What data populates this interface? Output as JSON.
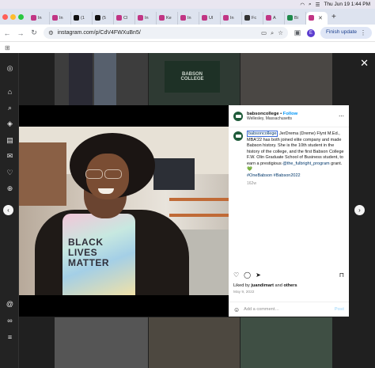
{
  "menubar": {
    "datetime": "Thu Jun 19  1:44 PM"
  },
  "tabs": [
    {
      "label": "In",
      "color": "#c13584"
    },
    {
      "label": "In",
      "color": "#c13584"
    },
    {
      "label": "(1",
      "color": "#111111"
    },
    {
      "label": "(5",
      "color": "#111111"
    },
    {
      "label": "Cl",
      "color": "#c13584"
    },
    {
      "label": "In",
      "color": "#c13584"
    },
    {
      "label": "Ke",
      "color": "#c13584"
    },
    {
      "label": "In",
      "color": "#c13584"
    },
    {
      "label": "Ul",
      "color": "#c13584"
    },
    {
      "label": "In",
      "color": "#c13584"
    },
    {
      "label": "Fc",
      "color": "#333333"
    },
    {
      "label": "A",
      "color": "#c13584"
    },
    {
      "label": "Bi",
      "color": "#1f8a4c"
    },
    {
      "label": "",
      "color": "#c13584"
    }
  ],
  "toolbar": {
    "url": "instagram.com/p/CdV4FWXuBn5/",
    "profile_initial": "E",
    "finish_update": "Finish update"
  },
  "post": {
    "username": "babsoncollege",
    "follow": "Follow",
    "location": "Wellesley, Massachusetts",
    "caption_mention": "babsoncollege",
    "caption_body": " JerDrema (Dreme) Flynt M.Ed., MBA'22 has both joined elite company and made Babson history. She is the 10th student in the history of the college, and the first Babson College F.W. Olin Graduate School of Business student, to earn a prestigious ",
    "caption_link": "@the_fulbright_program",
    "caption_after": " grant. 💚",
    "hashtags": "#OneBabson #Babson2022",
    "age": "162w",
    "liked_by_prefix": "Liked by ",
    "liked_by_user": "juandimart",
    "liked_by_suffix": " and ",
    "liked_by_others": "others",
    "date": "May 9, 2022",
    "comment_placeholder": "Add a comment…",
    "post_button": "Post"
  },
  "shirt_text": {
    "line1": "BLACK",
    "line2": "LIVES",
    "line3": "MATTER"
  },
  "background_sign": "BABSON COLLEGE",
  "colors": {
    "ig_link": "#0095f6",
    "mention": "#00376b",
    "favorite_green": "#1f5b3a"
  }
}
